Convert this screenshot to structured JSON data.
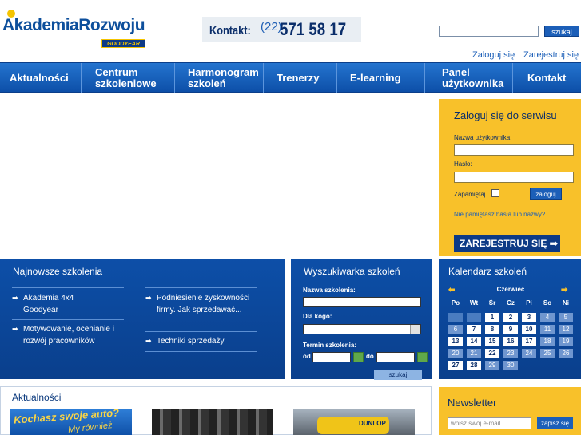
{
  "header": {
    "logo_brand_a": "Akademia",
    "logo_brand_b": "Rozwoju",
    "logo_sub": "GOODYEAR",
    "contact_label": "Kontakt:",
    "contact_prefix": "(22)",
    "contact_number": "571 58 17",
    "search_button": "szukaj",
    "login_link": "Zaloguj się",
    "register_link": "Zarejestruj się"
  },
  "nav": {
    "items": [
      {
        "label": "Aktualności"
      },
      {
        "label": "Centrum szkoleniowe"
      },
      {
        "label": "Harmonogram szkoleń"
      },
      {
        "label": "Trenerzy"
      },
      {
        "label": "E-learning"
      },
      {
        "label": "Panel użytkownika"
      },
      {
        "label": "Kontakt"
      }
    ]
  },
  "login": {
    "title": "Zaloguj się do serwisu",
    "username_label": "Nazwa użytkownika:",
    "password_label": "Hasło:",
    "remember_label": "Zapamiętaj",
    "submit": "zaloguj",
    "forgot": "Nie pamiętasz hasła lub nazwy?",
    "register": "ZAREJESTRUJ SIĘ ➡"
  },
  "latest": {
    "title": "Najnowsze szkolenia",
    "col1": [
      "Akademia 4x4 Goodyear",
      "Motywowanie, ocenianie i rozwój pracowników"
    ],
    "col2": [
      "Podniesienie zyskowności firmy. Jak sprzedawać...",
      "Techniki sprzedaży"
    ]
  },
  "search": {
    "title": "Wyszukiwarka szkoleń",
    "name_label": "Nazwa szkolenia:",
    "for_label": "Dla kogo:",
    "date_label": "Termin szkolenia:",
    "from": "od",
    "to": "do",
    "button": "szukaj"
  },
  "calendar": {
    "title": "Kalendarz szkoleń",
    "month": "Czerwiec",
    "prev": "⬅",
    "next": "➡",
    "weekdays": [
      "Po",
      "Wt",
      "Śr",
      "Cz",
      "Pi",
      "So",
      "Ni"
    ],
    "weeks": [
      [
        "",
        "",
        "1",
        "2",
        "3",
        "4",
        "5"
      ],
      [
        "6",
        "7",
        "8",
        "9",
        "10",
        "11",
        "12"
      ],
      [
        "13",
        "14",
        "15",
        "16",
        "17",
        "18",
        "19"
      ],
      [
        "20",
        "21",
        "22",
        "23",
        "24",
        "25",
        "26"
      ],
      [
        "27",
        "28",
        "29",
        "30",
        "",
        "",
        ""
      ]
    ],
    "highlighted": [
      "1",
      "2",
      "3",
      "7",
      "8",
      "9",
      "10",
      "13",
      "14",
      "15",
      "16",
      "17",
      "22",
      "27",
      "28"
    ]
  },
  "newsletter": {
    "title": "Newsletter",
    "placeholder": "wpisz swój e-mail...",
    "button": "zapisz się"
  },
  "news": {
    "title": "Aktualności",
    "thumb1_text": "Kochasz swoje auto?",
    "thumb1_sub": "My również",
    "thumb3_text": "DUNLOP"
  },
  "colors": {
    "nav_blue": "#0d4fa8",
    "panel_blue": "#0a3f8c",
    "yellow": "#f8c12a",
    "accent_green": "#5fa84b"
  }
}
